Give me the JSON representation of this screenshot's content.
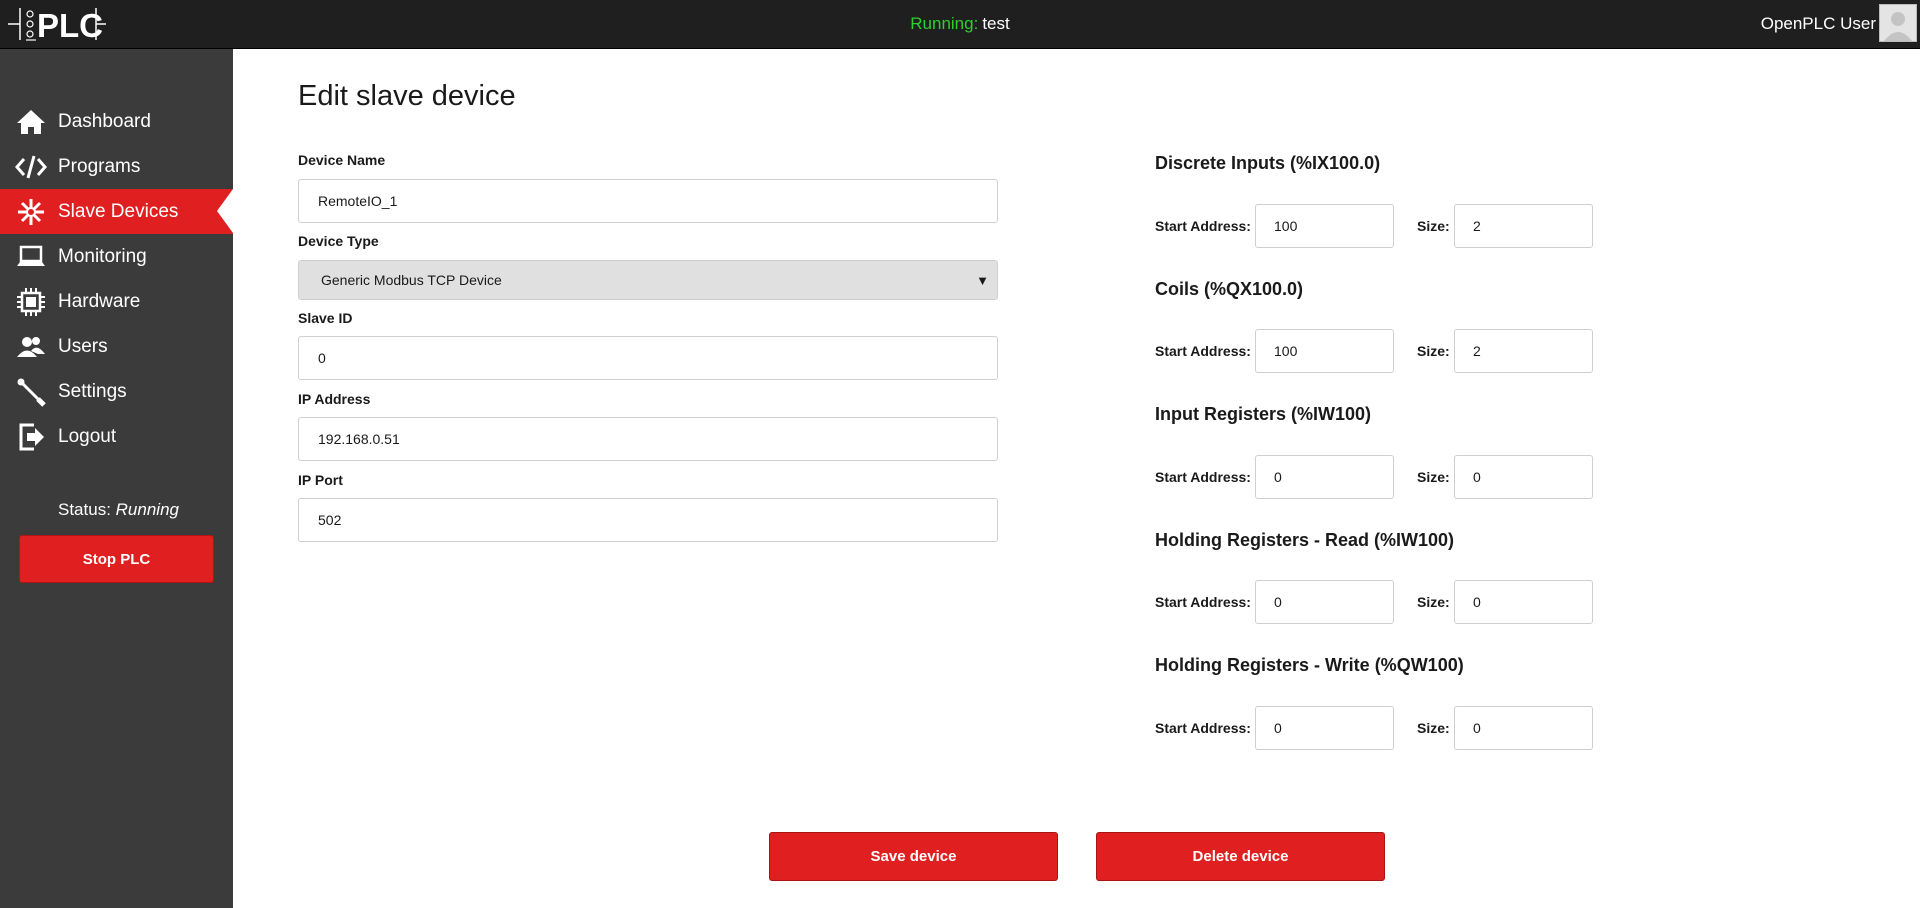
{
  "header": {
    "logo_text": "PLC",
    "run_label": "Running:",
    "program_name": "test",
    "user_name": "OpenPLC User"
  },
  "sidebar": {
    "items": [
      {
        "label": "Dashboard",
        "icon": "home-icon"
      },
      {
        "label": "Programs",
        "icon": "code-icon"
      },
      {
        "label": "Slave Devices",
        "icon": "gear-network-icon",
        "active": true
      },
      {
        "label": "Monitoring",
        "icon": "laptop-icon"
      },
      {
        "label": "Hardware",
        "icon": "chip-icon"
      },
      {
        "label": "Users",
        "icon": "users-icon"
      },
      {
        "label": "Settings",
        "icon": "wrench-icon"
      },
      {
        "label": "Logout",
        "icon": "logout-icon"
      }
    ],
    "status_label": "Status:",
    "status_value": "Running",
    "stop_button": "Stop PLC"
  },
  "main": {
    "title": "Edit slave device",
    "fields": {
      "device_name": {
        "label": "Device Name",
        "value": "RemoteIO_1"
      },
      "device_type": {
        "label": "Device Type",
        "value": "Generic Modbus TCP Device"
      },
      "slave_id": {
        "label": "Slave ID",
        "value": "0"
      },
      "ip_address": {
        "label": "IP Address",
        "value": "192.168.0.51"
      },
      "ip_port": {
        "label": "IP Port",
        "value": "502"
      }
    },
    "start_label": "Start Address:",
    "size_label": "Size:",
    "sections": [
      {
        "title": "Discrete Inputs (%IX100.0)",
        "start": "100",
        "size": "2"
      },
      {
        "title": "Coils (%QX100.0)",
        "start": "100",
        "size": "2"
      },
      {
        "title": "Input Registers (%IW100)",
        "start": "0",
        "size": "0"
      },
      {
        "title": "Holding Registers - Read (%IW100)",
        "start": "0",
        "size": "0"
      },
      {
        "title": "Holding Registers - Write (%QW100)",
        "start": "0",
        "size": "0"
      }
    ],
    "save_button": "Save device",
    "delete_button": "Delete device"
  },
  "colors": {
    "accent": "#e02020",
    "sidebar_bg": "#3b3b3b",
    "topbar_bg": "#1f1f1f",
    "running_green": "#2dd12d"
  }
}
